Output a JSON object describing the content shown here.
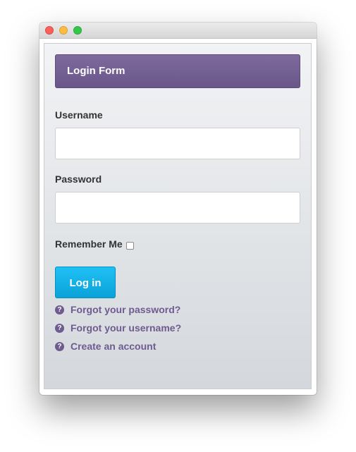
{
  "window": {
    "controls": [
      "close-button",
      "minimize-button",
      "maximize-button"
    ]
  },
  "form": {
    "title": "Login Form",
    "username_label": "Username",
    "username_value": "",
    "password_label": "Password",
    "password_value": "",
    "remember_label": "Remember Me",
    "remember_checked": false,
    "submit_label": "Log in",
    "links": [
      {
        "label": "Forgot your password?",
        "icon": "help-icon"
      },
      {
        "label": "Forgot your username?",
        "icon": "help-icon"
      },
      {
        "label": "Create an account",
        "icon": "help-icon"
      }
    ]
  },
  "colors": {
    "header": "#7b6799",
    "button": "#12b1e8",
    "link": "#6f5b8f"
  }
}
